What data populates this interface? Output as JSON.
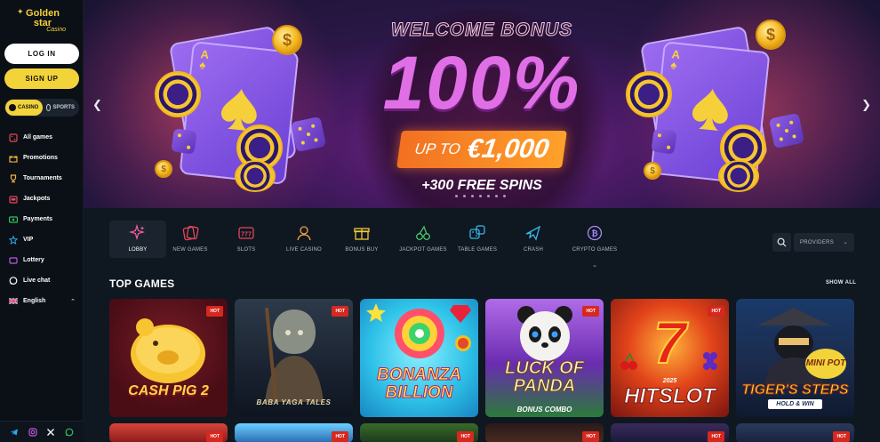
{
  "brand": {
    "line1": "Golden",
    "line2": "star",
    "line3": "Casino"
  },
  "auth": {
    "login": "LOG IN",
    "signup": "SIGN UP"
  },
  "mode_tabs": {
    "casino": "CASINO",
    "sports": "SPORTS"
  },
  "sidebar": {
    "items": [
      {
        "label": "All games",
        "icon": "dice-icon",
        "color": "#e5475b"
      },
      {
        "label": "Promotions",
        "icon": "gift-icon",
        "color": "#f2b53a"
      },
      {
        "label": "Tournaments",
        "icon": "trophy-icon",
        "color": "#f2b53a"
      },
      {
        "label": "Jackpots",
        "icon": "jackpot-icon",
        "color": "#e5475b"
      },
      {
        "label": "Payments",
        "icon": "payments-icon",
        "color": "#31c15f"
      },
      {
        "label": "VIP",
        "icon": "vip-icon",
        "color": "#2ea8f2"
      },
      {
        "label": "Lottery",
        "icon": "lottery-icon",
        "color": "#c357e6"
      },
      {
        "label": "Live chat",
        "icon": "chat-icon",
        "color": "#ffffff"
      }
    ],
    "language": {
      "label": "English",
      "icon": "uk-flag-icon"
    }
  },
  "social": [
    "telegram-icon",
    "instagram-icon",
    "x-icon",
    "whatsapp-icon"
  ],
  "banner": {
    "headline": "WELCOME BONUS",
    "percent": "100%",
    "upto_prefix": "UP TO",
    "upto_amount": "€1,000",
    "free_spins": "+300 FREE SPINS",
    "slide_count": 7
  },
  "categories": [
    {
      "label": "LOBBY",
      "icon": "lobby-sparkle-icon",
      "color": "#ff5fa8",
      "active": true
    },
    {
      "label": "NEW GAMES",
      "icon": "new-games-icon",
      "color": "#e5475b"
    },
    {
      "label": "SLOTS",
      "icon": "slots-icon",
      "color": "#e5475b"
    },
    {
      "label": "LIVE CASINO",
      "icon": "live-dealer-icon",
      "color": "#f2a23a"
    },
    {
      "label": "BONUS BUY",
      "icon": "bonus-buy-icon",
      "color": "#f2c83a"
    },
    {
      "label": "JACKPOT GAMES",
      "icon": "cherry-icon",
      "color": "#4cc56f"
    },
    {
      "label": "TABLE GAMES",
      "icon": "table-games-icon",
      "color": "#3ab6e8"
    },
    {
      "label": "CRASH",
      "icon": "plane-icon",
      "color": "#3ab6e8"
    },
    {
      "label": "CRYPTO GAMES",
      "icon": "crypto-icon",
      "color": "#a98bff",
      "dropdown": true
    }
  ],
  "providers_label": "PROVIDERS",
  "top_games": {
    "title": "TOP GAMES",
    "show_all": "SHOW ALL",
    "games": [
      {
        "name": "CASH PIG 2",
        "badge": "HOT"
      },
      {
        "name": "BABA YAGA TALES",
        "badge": "HOT"
      },
      {
        "name": "BONANZA BILLION",
        "badge": "HOT"
      },
      {
        "name": "LUCK OF PANDA",
        "subtitle": "BONUS COMBO",
        "badge": "HOT"
      },
      {
        "name": "HITSLOT",
        "year": "2025",
        "badge": "HOT"
      },
      {
        "name": "TIGER'S STEPS",
        "subtitle": "HOLD & WIN",
        "extra": "MINI POT",
        "badge": "HOT"
      }
    ],
    "row2_badges": [
      "HOT",
      "HOT",
      "HOT",
      "HOT",
      "HOT",
      "HOT"
    ]
  }
}
